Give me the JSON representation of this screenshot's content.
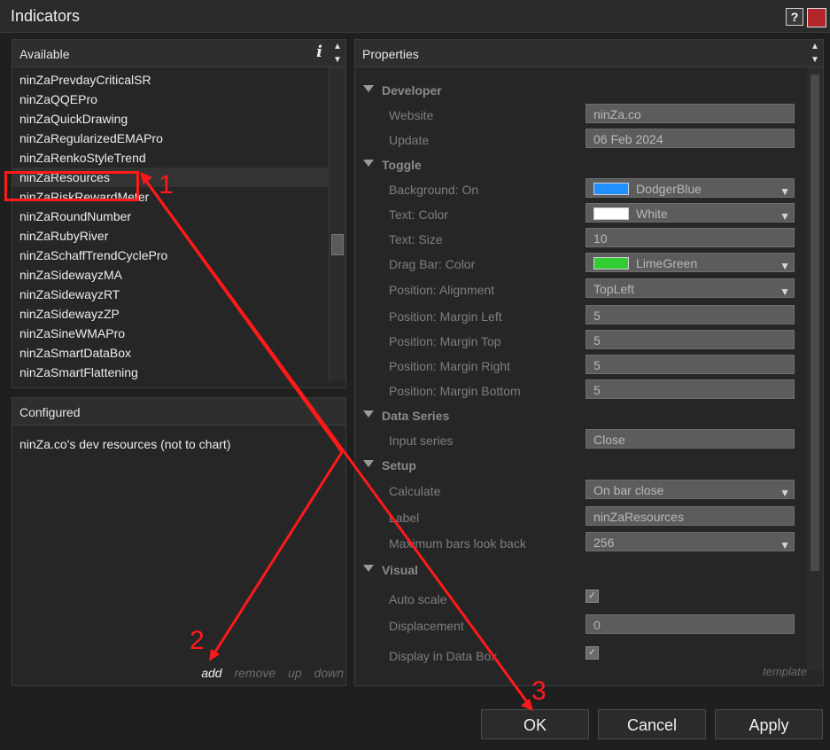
{
  "window": {
    "title": "Indicators",
    "help_label": "?"
  },
  "available": {
    "header": "Available",
    "info_label": "i",
    "items": [
      "ninZaPrevdayCriticalSR",
      "ninZaQQEPro",
      "ninZaQuickDrawing",
      "ninZaRegularizedEMAPro",
      "ninZaRenkoStyleTrend",
      "ninZaResources",
      "ninZaRiskRewardMeter",
      "ninZaRoundNumber",
      "ninZaRubyRiver",
      "ninZaSchaffTrendCyclePro",
      "ninZaSidewayzMA",
      "ninZaSidewayzRT",
      "ninZaSidewayzZP",
      "ninZaSineWMAPro",
      "ninZaSmartDataBox",
      "ninZaSmartFlattening"
    ],
    "selected_item": "ninZaResources"
  },
  "configured": {
    "header": "Configured",
    "item": "ninZa.co's dev resources (not to chart)",
    "actions": {
      "add": "add",
      "remove": "remove",
      "up": "up",
      "down": "down"
    }
  },
  "properties": {
    "header": "Properties",
    "template": "template",
    "categories": {
      "developer": "Developer",
      "toggle": "Toggle",
      "data_series": "Data Series",
      "setup": "Setup",
      "visual": "Visual"
    },
    "rows": {
      "website": {
        "name": "Website",
        "value": "ninZa.co"
      },
      "update": {
        "name": "Update",
        "value": "06 Feb 2024"
      },
      "background_on": {
        "name": "Background: On",
        "value": "DodgerBlue",
        "color": "#1e90ff"
      },
      "text_color": {
        "name": "Text: Color",
        "value": "White",
        "color": "#ffffff"
      },
      "text_size": {
        "name": "Text: Size",
        "value": "10"
      },
      "drag_bar_color": {
        "name": "Drag Bar: Color",
        "value": "LimeGreen",
        "color": "#32cd32"
      },
      "position_alignment": {
        "name": "Position: Alignment",
        "value": "TopLeft"
      },
      "margin_left": {
        "name": "Position: Margin Left",
        "value": "5"
      },
      "margin_top": {
        "name": "Position: Margin Top",
        "value": "5"
      },
      "margin_right": {
        "name": "Position: Margin Right",
        "value": "5"
      },
      "margin_bottom": {
        "name": "Position: Margin Bottom",
        "value": "5"
      },
      "input_series": {
        "name": "Input series",
        "value": "Close"
      },
      "calculate": {
        "name": "Calculate",
        "value": "On bar close"
      },
      "label": {
        "name": "Label",
        "value": "ninZaResources"
      },
      "max_bars": {
        "name": "Maximum bars look back",
        "value": "256"
      },
      "auto_scale": {
        "name": "Auto scale",
        "checked": true
      },
      "displacement": {
        "name": "Displacement",
        "value": "0"
      },
      "display_in_data_box": {
        "name": "Display in Data Box",
        "checked": true
      }
    }
  },
  "buttons": {
    "ok": "OK",
    "cancel": "Cancel",
    "apply": "Apply"
  },
  "annotations": {
    "step1": "1",
    "step2": "2",
    "step3": "3",
    "color": "#ff1a1a"
  }
}
